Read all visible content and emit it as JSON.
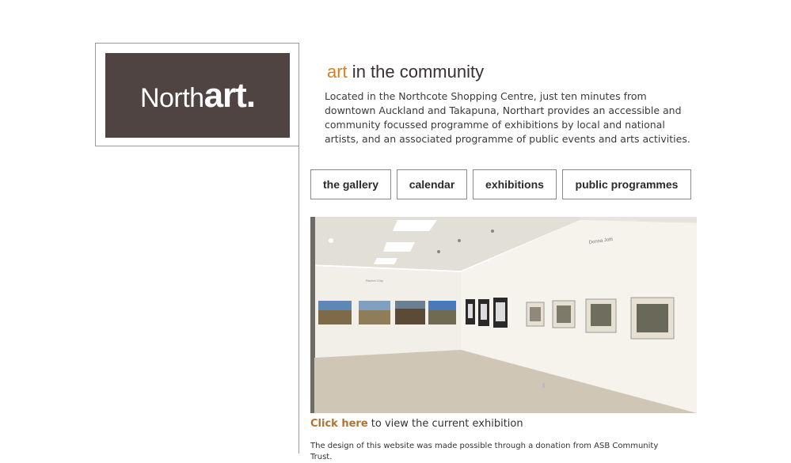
{
  "logo": {
    "prefix": "North",
    "suffix": "art.",
    "bg_color": "#4f4441"
  },
  "headline": {
    "accent": "art",
    "rest": " in the community",
    "accent_color": "#d97d24"
  },
  "intro": "Located in the Northcote Shopping Centre, just ten minutes from downtown Auckland and Takapuna, Northart provides an accessible and community focussed programme of exhibitions by local and national artists, and an associated programme of public events and arts activities.",
  "nav": {
    "gallery": "the gallery",
    "calendar": "calendar",
    "exhibitions": "exhibitions",
    "public_programmes": "public programmes"
  },
  "photo": {
    "wall_label": "Donna Jotti"
  },
  "cta": {
    "link": "Click here",
    "text": " to view the current exhibition"
  },
  "footer_note": "The design of this website was made possible through a donation from ASB Community Trust."
}
